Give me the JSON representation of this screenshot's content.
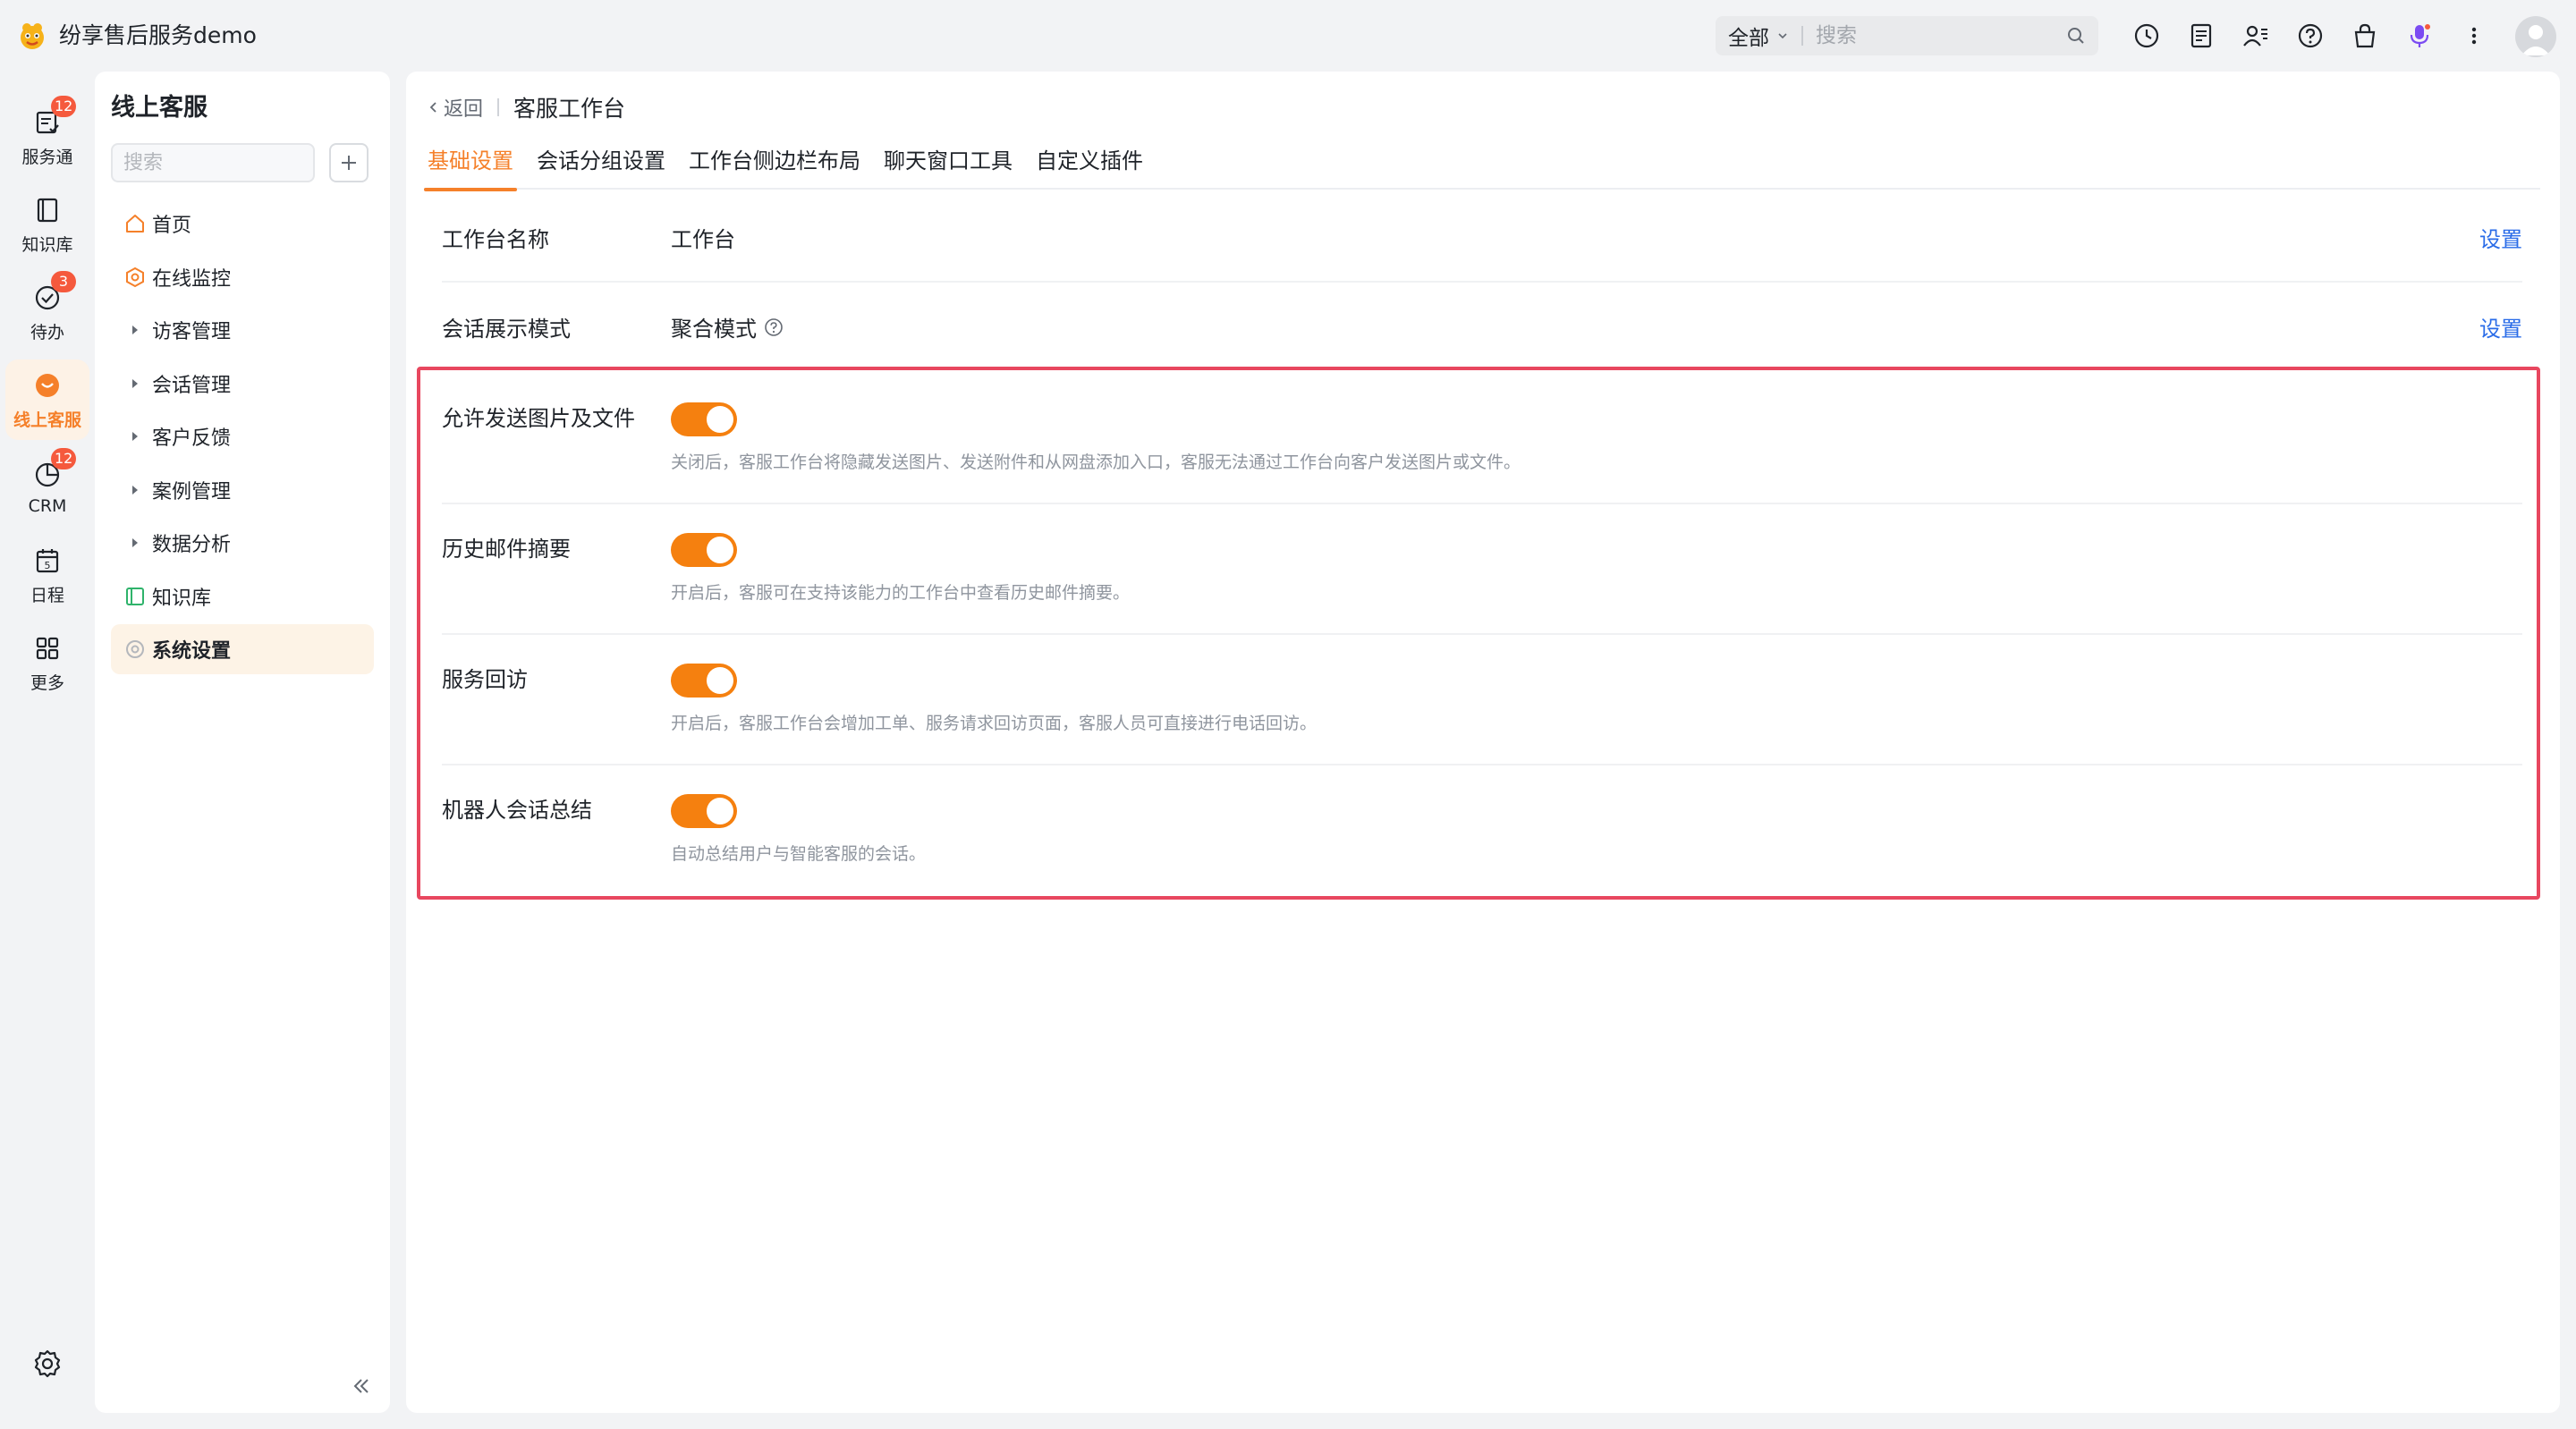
{
  "app": {
    "title": "纷享售后服务demo"
  },
  "topbar": {
    "scope": "全部",
    "search_placeholder": "搜索",
    "icons": [
      "clock-icon",
      "document-icon",
      "contacts-icon",
      "help-icon",
      "bag-icon",
      "mic-icon",
      "more-vertical-icon"
    ]
  },
  "rail": {
    "items": [
      {
        "label": "服务通",
        "icon": "service-icon",
        "badge": "12"
      },
      {
        "label": "知识库",
        "icon": "book-icon",
        "badge": ""
      },
      {
        "label": "待办",
        "icon": "check-icon",
        "badge": "3"
      },
      {
        "label": "线上客服",
        "icon": "chat-icon",
        "badge": "",
        "active": true
      },
      {
        "label": "CRM",
        "icon": "crm-icon",
        "badge": "12"
      },
      {
        "label": "日程",
        "icon": "calendar-icon",
        "badge": ""
      },
      {
        "label": "更多",
        "icon": "grid-icon",
        "badge": ""
      }
    ],
    "calendar_day": "5"
  },
  "sidebar": {
    "title": "线上客服",
    "search_placeholder": "搜索",
    "items": [
      {
        "label": "首页",
        "icon": "home-icon"
      },
      {
        "label": "在线监控",
        "icon": "monitor-icon"
      },
      {
        "label": "访客管理",
        "icon": "caret-right-icon"
      },
      {
        "label": "会话管理",
        "icon": "caret-right-icon"
      },
      {
        "label": "客户反馈",
        "icon": "caret-right-icon"
      },
      {
        "label": "案例管理",
        "icon": "caret-right-icon"
      },
      {
        "label": "数据分析",
        "icon": "caret-right-icon"
      },
      {
        "label": "知识库",
        "icon": "knowledge-icon"
      },
      {
        "label": "系统设置",
        "icon": "settings-icon",
        "active": true
      }
    ]
  },
  "main": {
    "back_label": "返回",
    "page_title": "客服工作台",
    "tabs": [
      "基础设置",
      "会话分组设置",
      "工作台侧边栏布局",
      "聊天窗口工具",
      "自定义插件"
    ],
    "rows": [
      {
        "label": "工作台名称",
        "value": "工作台",
        "action": "设置"
      },
      {
        "label": "会话展示模式",
        "value": "聚合模式",
        "action": "设置"
      }
    ],
    "toggles": [
      {
        "label": "允许发送图片及文件",
        "on": true,
        "desc": "关闭后，客服工作台将隐藏发送图片、发送附件和从网盘添加入口，客服无法通过工作台向客户发送图片或文件。"
      },
      {
        "label": "历史邮件摘要",
        "on": true,
        "desc": "开启后，客服可在支持该能力的工作台中查看历史邮件摘要。"
      },
      {
        "label": "服务回访",
        "on": true,
        "desc": "开启后，客服工作台会增加工单、服务请求回访页面，客服人员可直接进行电话回访。"
      },
      {
        "label": "机器人会话总结",
        "on": true,
        "desc": "自动总结用户与智能客服的会话。"
      }
    ]
  },
  "colors": {
    "accent": "#f5802a",
    "toggle_on": "#f5800f",
    "link": "#2a6ce8",
    "highlight_border": "#e8475f",
    "badge": "#f5593d"
  }
}
